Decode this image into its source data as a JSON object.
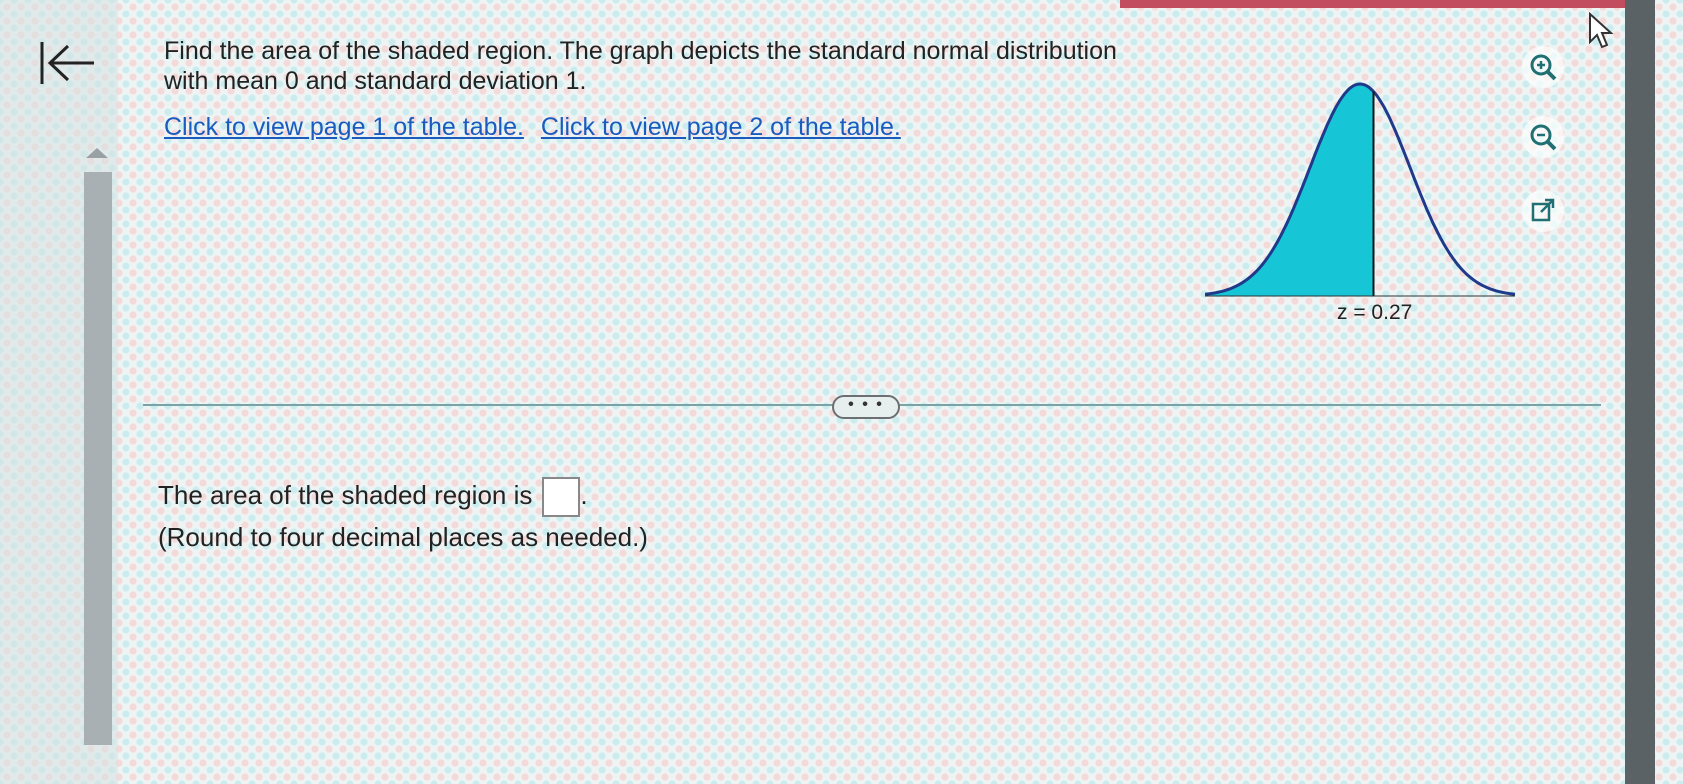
{
  "question": {
    "text": "Find the area of the shaded region. The graph depicts the standard normal distribution with mean 0 and standard deviation 1."
  },
  "links": {
    "table_page_1": "Click to view page 1 of the table.",
    "table_page_2": "Click to view page 2 of the table."
  },
  "graph": {
    "z_label": "z = 0.27",
    "shaded_side": "left",
    "z_value": 0.27,
    "fill_color": "#17c6d6",
    "curve_color": "#1f3a8a"
  },
  "toolbar": {
    "zoom_in_icon": "zoom-in-icon",
    "zoom_out_icon": "zoom-out-icon",
    "popout_icon": "external-link-icon"
  },
  "divider": {
    "more_label": "• • •"
  },
  "answer": {
    "prompt": "The area of the shaded region is",
    "suffix": ".",
    "instruction": "(Round to four decimal places as needed.)",
    "value": ""
  }
}
